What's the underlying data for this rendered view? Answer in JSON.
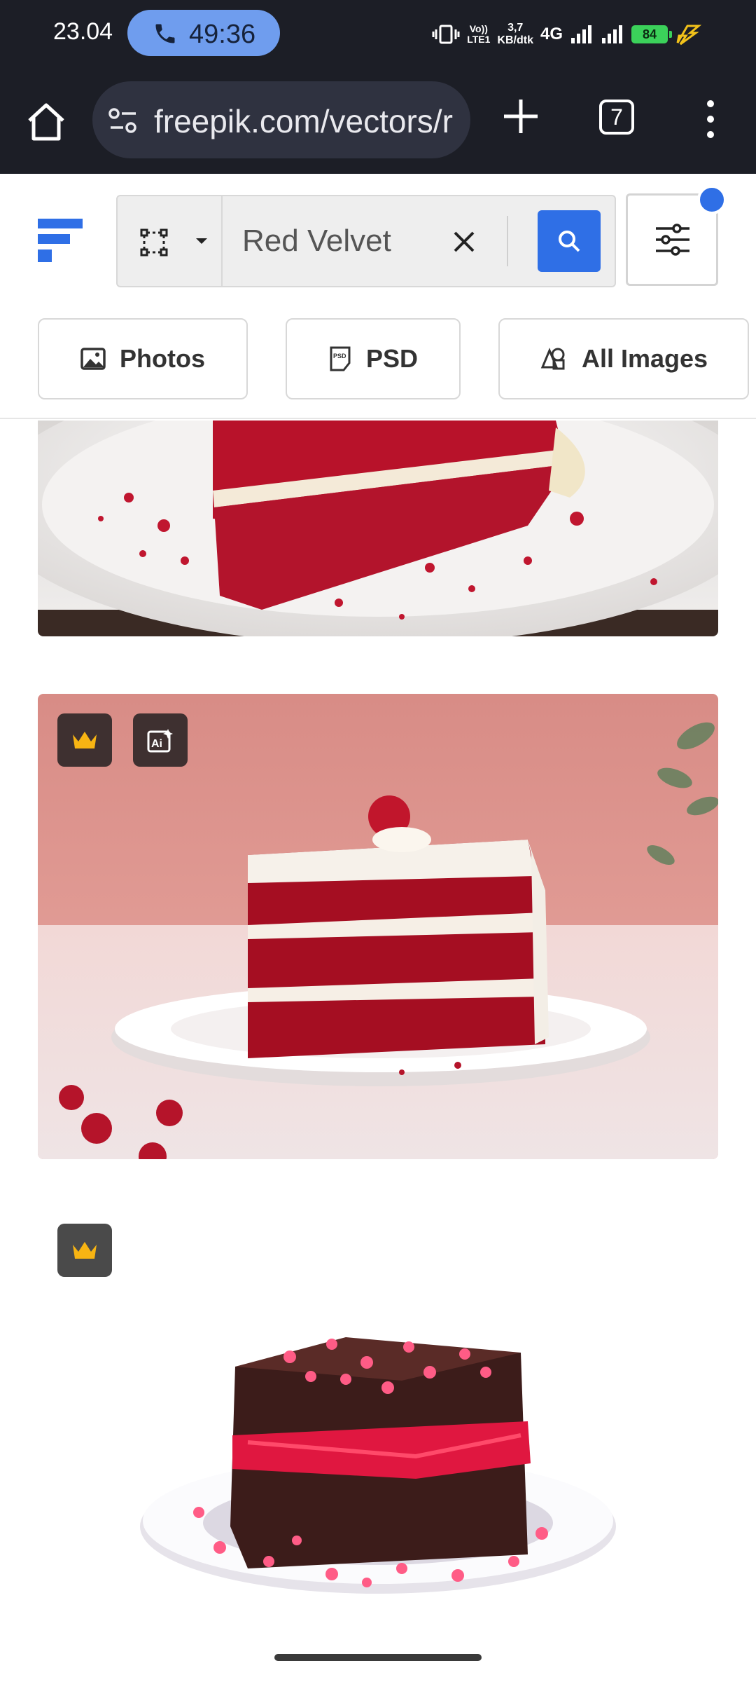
{
  "status_bar": {
    "time": "23.04",
    "call_timer": "49:36",
    "network_rate_value": "3,7",
    "network_rate_unit": "KB/dtk",
    "volte_top": "Vo))",
    "volte_bottom": "LTE1",
    "network_type": "4G",
    "battery_level": "84",
    "battery_color": "#3bd15a"
  },
  "browser": {
    "url": "freepik.com/vectors/r",
    "tab_count": "7"
  },
  "site": {
    "brand_color": "#2f6fe6",
    "search": {
      "value": "Red Velvet",
      "placeholder": ""
    },
    "chips": [
      {
        "label": "Photos",
        "icon": "image-icon"
      },
      {
        "label": "PSD",
        "icon": "psd-icon"
      },
      {
        "label": "All Images",
        "icon": "shapes-icon"
      }
    ]
  },
  "results": [
    {
      "type": "photo",
      "subject": "red velvet cake slice on plate (cropped)",
      "badges": []
    },
    {
      "type": "photo",
      "subject": "red velvet cake slice with raspberry",
      "badges": [
        "premium-crown-icon",
        "ai-generated-icon"
      ]
    },
    {
      "type": "vector",
      "subject": "chocolate cake with red layer and hearts",
      "badges": [
        "premium-crown-icon"
      ]
    }
  ]
}
